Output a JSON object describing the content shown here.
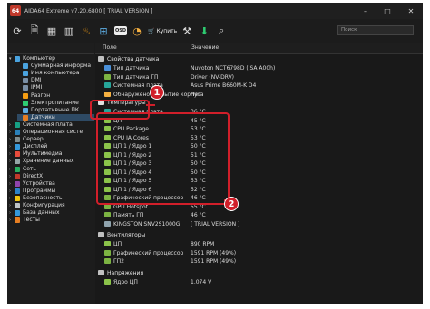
{
  "window": {
    "app_icon_text": "64",
    "title": "AIDA64 Extreme v7.20.6800 [ TRIAL VERSION ]",
    "min": "–",
    "max": "□",
    "close": "✕"
  },
  "toolbar": {
    "buy_label": "Купить",
    "search_placeholder": "Поиск",
    "osd_label": "OSD"
  },
  "tree": [
    {
      "label": "Компьютер",
      "level": 1,
      "expanded": true,
      "color": "#4aa3df"
    },
    {
      "label": "Суммарная информа",
      "level": 2,
      "color": "#4aa3df"
    },
    {
      "label": "Имя компьютера",
      "level": 2,
      "color": "#4aa3df"
    },
    {
      "label": "DMI",
      "level": 2,
      "color": "#7a8fa6"
    },
    {
      "label": "IPMI",
      "level": 2,
      "color": "#7a8fa6"
    },
    {
      "label": "Разгон",
      "level": 2,
      "color": "#f39c12"
    },
    {
      "label": "Электропитание",
      "level": 2,
      "color": "#2ecc71"
    },
    {
      "label": "Портативные ПК",
      "level": 2,
      "color": "#5dade2"
    },
    {
      "label": "Датчики",
      "level": 2,
      "color": "#e67e22",
      "selected": true
    },
    {
      "label": "Системная плата",
      "level": 1,
      "color": "#16a085"
    },
    {
      "label": "Операционная систе",
      "level": 1,
      "color": "#2980b9"
    },
    {
      "label": "Сервер",
      "level": 1,
      "color": "#7f8c8d"
    },
    {
      "label": "Дисплей",
      "level": 1,
      "color": "#3498db"
    },
    {
      "label": "Мультимедиа",
      "level": 1,
      "color": "#e74c3c"
    },
    {
      "label": "Хранение данных",
      "level": 1,
      "color": "#95a5a6"
    },
    {
      "label": "Сеть",
      "level": 1,
      "color": "#27ae60"
    },
    {
      "label": "DirectX",
      "level": 1,
      "color": "#c0392b"
    },
    {
      "label": "Устройства",
      "level": 1,
      "color": "#8e44ad"
    },
    {
      "label": "Программы",
      "level": 1,
      "color": "#2c82c9"
    },
    {
      "label": "Безопасность",
      "level": 1,
      "color": "#f1c40f"
    },
    {
      "label": "Конфигурация",
      "level": 1,
      "color": "#bdc3c7"
    },
    {
      "label": "База данных",
      "level": 1,
      "color": "#3498db"
    },
    {
      "label": "Тесты",
      "level": 1,
      "color": "#e67e22"
    }
  ],
  "columns": {
    "field": "Поле",
    "value": "Значение"
  },
  "rows": [
    {
      "kind": "section",
      "name": "Свойства датчика",
      "value": "",
      "color": "#c0c0c0"
    },
    {
      "kind": "item",
      "name": "Тип датчика",
      "value": "Nuvoton NCT6798D (ISA A00h)",
      "color": "#4a90d9"
    },
    {
      "kind": "item",
      "name": "Тип датчика ГП",
      "value": "Driver (NV-DRV)",
      "color": "#7cb342"
    },
    {
      "kind": "item",
      "name": "Системная плата",
      "value": "Asus Prime B660M-K D4",
      "color": "#26a69a"
    },
    {
      "kind": "item",
      "name": "Обнаружено вскрытие корпуса",
      "value": "Нет",
      "color": "#f5b041"
    },
    {
      "kind": "section",
      "name": "Температуры",
      "value": "",
      "color": "#e0e0e0"
    },
    {
      "kind": "item",
      "name": "Системная плата",
      "value": "36 °C",
      "color": "#26a69a"
    },
    {
      "kind": "item",
      "name": "ЦП",
      "value": "45 °C",
      "color": "#8bc34a"
    },
    {
      "kind": "item",
      "name": "CPU Package",
      "value": "53 °C",
      "color": "#8bc34a"
    },
    {
      "kind": "item",
      "name": "CPU IA Cores",
      "value": "53 °C",
      "color": "#8bc34a"
    },
    {
      "kind": "item",
      "name": "ЦП 1 / Ядро 1",
      "value": "50 °C",
      "color": "#8bc34a"
    },
    {
      "kind": "item",
      "name": "ЦП 1 / Ядро 2",
      "value": "51 °C",
      "color": "#8bc34a"
    },
    {
      "kind": "item",
      "name": "ЦП 1 / Ядро 3",
      "value": "50 °C",
      "color": "#8bc34a"
    },
    {
      "kind": "item",
      "name": "ЦП 1 / Ядро 4",
      "value": "50 °C",
      "color": "#8bc34a"
    },
    {
      "kind": "item",
      "name": "ЦП 1 / Ядро 5",
      "value": "53 °C",
      "color": "#8bc34a"
    },
    {
      "kind": "item",
      "name": "ЦП 1 / Ядро 6",
      "value": "52 °C",
      "color": "#8bc34a"
    },
    {
      "kind": "item",
      "name": "Графический процессор",
      "value": "46 °C",
      "color": "#7cb342"
    },
    {
      "kind": "item",
      "name": "GPU Hotspot",
      "value": "55 °C",
      "color": "#7cb342"
    },
    {
      "kind": "item",
      "name": "Память ГП",
      "value": "46 °C",
      "color": "#7cb342"
    },
    {
      "kind": "item",
      "name": "KINGSTON SNV2S1000G",
      "value": "[ TRIAL VERSION ]",
      "color": "#90a4ae"
    },
    {
      "kind": "gap",
      "name": "",
      "value": "",
      "color": ""
    },
    {
      "kind": "section",
      "name": "Вентиляторы",
      "value": "",
      "color": "#c0c0c0"
    },
    {
      "kind": "item",
      "name": "ЦП",
      "value": "890 RPM",
      "color": "#8bc34a"
    },
    {
      "kind": "item",
      "name": "Графический процессор",
      "value": "1591 RPM (49%)",
      "color": "#7cb342"
    },
    {
      "kind": "item",
      "name": "ГП2",
      "value": "1591 RPM (49%)",
      "color": "#7cb342"
    },
    {
      "kind": "gap",
      "name": "",
      "value": "",
      "color": ""
    },
    {
      "kind": "section",
      "name": "Напряжения",
      "value": "",
      "color": "#c0c0c0"
    },
    {
      "kind": "item",
      "name": "Ядро ЦП",
      "value": "1.074 V",
      "color": "#8bc34a"
    }
  ],
  "callouts": {
    "badge1": "1",
    "badge2": "2"
  },
  "accent": "#d11f2a"
}
